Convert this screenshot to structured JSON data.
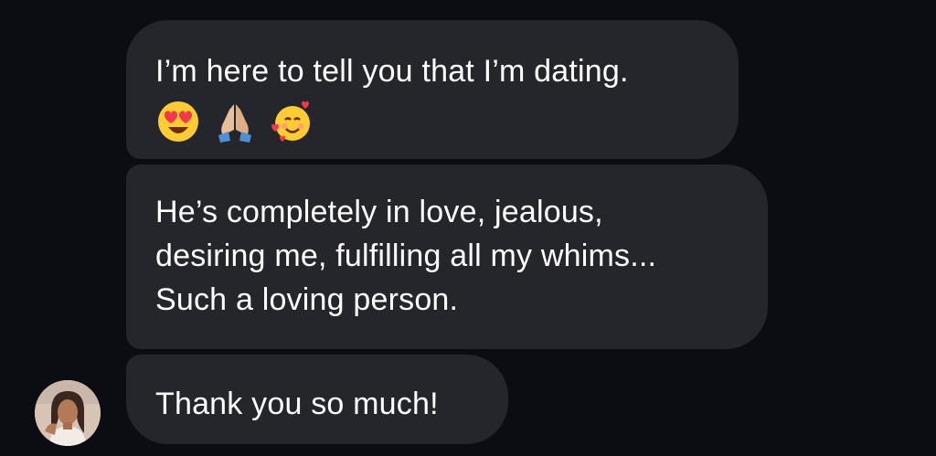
{
  "messages": [
    {
      "lines": [
        "I’m here to tell you that I’m dating."
      ],
      "emojis": [
        "heart-eyes-face",
        "folded-hands",
        "smiling-face-with-hearts"
      ]
    },
    {
      "lines": [
        "He’s completely in love, jealous,",
        "desiring me, fulfilling all my whims...",
        "Such a loving person."
      ]
    },
    {
      "lines": [
        "Thank you so much!"
      ]
    }
  ],
  "colors": {
    "background": "#0b0d12",
    "bubble": "#25262c",
    "text": "#ffffff"
  },
  "sender": {
    "avatar": "avatar-photo"
  }
}
